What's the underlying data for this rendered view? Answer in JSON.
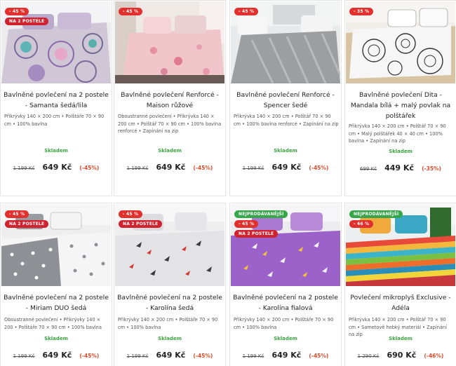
{
  "products": [
    {
      "badges": [
        "- 45 %",
        "NA 2 POSTELE"
      ],
      "title": "Bavlněné povlečení na 2 postele - Samanta šedá/lila",
      "desc": "Přikrývky 140 × 200 cm • Polštáře 70 × 90 cm • 100% bavlna",
      "stock": "Skladem",
      "old_price": "1 199 Kč",
      "price": "649 Kč",
      "discount": "(-45%)",
      "image": "bedding-mandala-purple"
    },
    {
      "badges": [
        "- 45 %"
      ],
      "title": "Bavlněné povlečení Renforcé - Maison růžové",
      "desc": "Oboustranné povlečení • Přikrývka 140 × 200 cm • Polštář 70 × 90 cm • 100% bavlna renforcé • Zapínání na zip",
      "stock": "Skladem",
      "old_price": "1 199 Kč",
      "price": "649 Kč",
      "discount": "(-45%)",
      "image": "bedding-pink-floral"
    },
    {
      "badges": [
        "- 45 %"
      ],
      "title": "Bavlněné povlečení Renforcé - Spencer šedé",
      "desc": "Přikrývka 140 × 200 cm • Polštář 70 × 90 cm • 100% bavlna renforcé • Zapínání na zip",
      "stock": "Skladem",
      "old_price": "1 199 Kč",
      "price": "649 Kč",
      "discount": "(-45%)",
      "image": "bedding-grey-stripes"
    },
    {
      "badges": [
        "- 35 %"
      ],
      "title": "Bavlněné povlečení Dita - Mandala bílá + malý povlak na polštářek",
      "desc": "Přikrývka 140 × 200 cm • Polštář 70 × 90 cm • Malý polštářek 40 × 40 cm • 100% bavlna • Zapínání na zip",
      "stock": "Skladem",
      "old_price": "699 Kč",
      "price": "449 Kč",
      "discount": "(-35%)",
      "image": "bedding-mandala-white"
    },
    {
      "badges": [
        "- 45 %",
        "NA 2 POSTELE"
      ],
      "title": "Bavlněné povlečení na 2 postele - Miriam DUO šedá",
      "desc": "Oboustranné povlečení • Přikrývky 140 × 200 • Polštáře 70 × 90 cm • 100% bavlna",
      "stock": "Skladem",
      "old_price": "1 199 Kč",
      "price": "649 Kč",
      "discount": "(-45%)",
      "image": "bedding-grey-stars"
    },
    {
      "badges": [
        "- 45 %",
        "NA 2 POSTELE"
      ],
      "title": "Bavlněné povlečení na 2 postele - Karolína šedá",
      "desc": "Přikrývky 140 × 200 cm • Polštáře 70 × 90 cm • 100% bavlna",
      "stock": "Skladem",
      "old_price": "1 199 Kč",
      "price": "649 Kč",
      "discount": "(-45%)",
      "image": "bedding-butterflies-grey"
    },
    {
      "badges": [
        "NEJPRODÁVANĚJŠÍ",
        "- 45 %",
        "NA 2 POSTELE"
      ],
      "title": "Bavlněné povlečení na 2 postele - Karolína fialová",
      "desc": "Přikrývky 140 × 200 cm • Polštáře 70 × 90 cm • 100% bavlna",
      "stock": "Skladem",
      "old_price": "1 199 Kč",
      "price": "649 Kč",
      "discount": "(-45%)",
      "image": "bedding-butterflies-purple"
    },
    {
      "badges": [
        "NEJPRODÁVANĚJŠÍ",
        "- 46 %"
      ],
      "title": "Povlečení mikroplyš Exclusive - Adéla",
      "desc": "Přikrývka 140 × 200 cm • Polštář 70 × 90 cm • Sametově hebký materiál • Zapínání na zip",
      "stock": "Skladem",
      "old_price": "1 290 Kč",
      "price": "690 Kč",
      "discount": "(-46%)",
      "image": "bedding-colorful-stripes"
    }
  ]
}
